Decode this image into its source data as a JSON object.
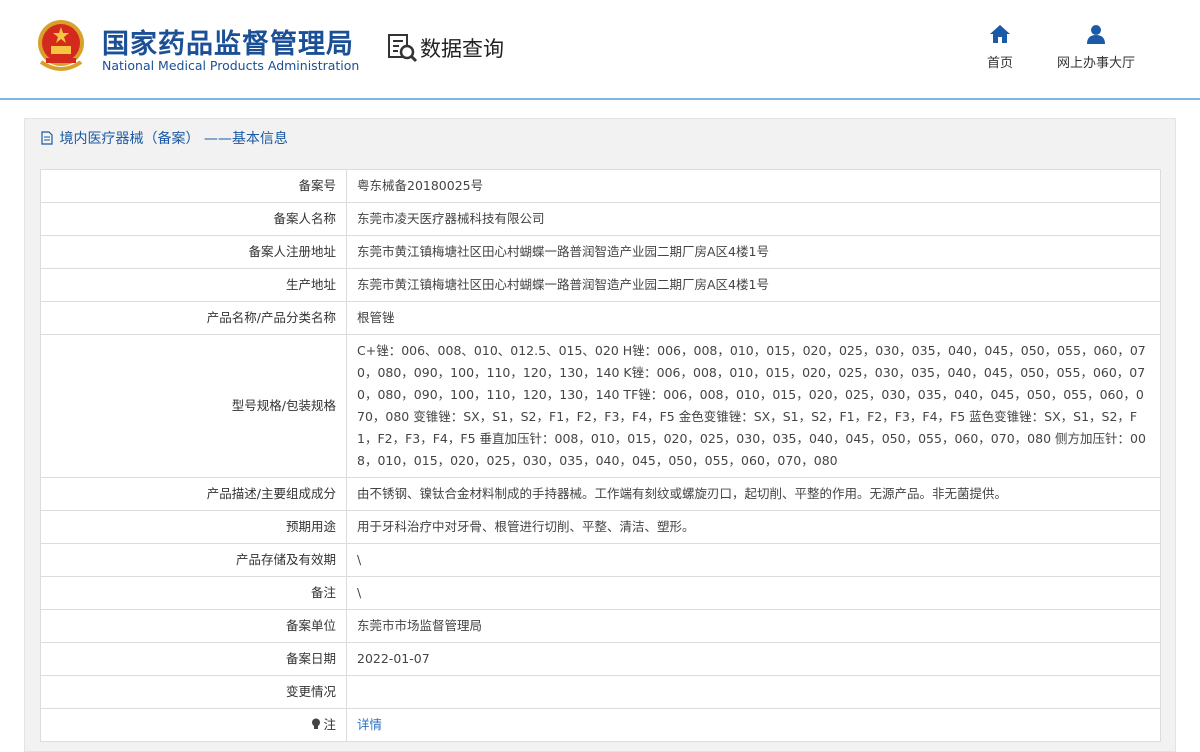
{
  "header": {
    "org_name_cn": "国家药品监督管理局",
    "org_name_en": "National Medical Products Administration",
    "section_title": "数据查询",
    "nav": [
      {
        "label": "首页",
        "icon": "home-icon"
      },
      {
        "label": "网上办事大厅",
        "icon": "user-icon"
      }
    ]
  },
  "panel": {
    "title": "境内医疗器械（备案） ——基本信息"
  },
  "record": [
    {
      "label": "备案号",
      "value": "粤东械备20180025号"
    },
    {
      "label": "备案人名称",
      "value": "东莞市凌天医疗器械科技有限公司"
    },
    {
      "label": "备案人注册地址",
      "value": "东莞市黄江镇梅塘社区田心村蝴蝶一路普润智造产业园二期厂房A区4楼1号"
    },
    {
      "label": "生产地址",
      "value": "东莞市黄江镇梅塘社区田心村蝴蝶一路普润智造产业园二期厂房A区4楼1号"
    },
    {
      "label": "产品名称/产品分类名称",
      "value": "根管锉"
    },
    {
      "label": "型号规格/包装规格",
      "value": "C+锉：006、008、010、012.5、015、020 H锉：006，008，010，015，020，025，030，035，040，045，050，055，060，070，080，090，100，110，120，130，140 K锉：006，008，010，015，020，025，030，035，040，045，050，055，060，070，080，090，100，110，120，130，140 TF锉：006，008，010，015，020，025，030，035，040，045，050，055，060，070，080 变锥锉：SX，S1，S2，F1，F2，F3，F4，F5 金色变锥锉：SX，S1，S2，F1，F2，F3，F4，F5 蓝色变锥锉：SX，S1，S2，F1，F2，F3，F4，F5 垂直加压针：008，010，015，020，025，030，035，040，045，050，055，060，070，080 侧方加压针：008，010，015，020，025，030，035，040，045，050，055，060，070，080"
    },
    {
      "label": "产品描述/主要组成成分",
      "value": "由不锈钢、镍钛合金材料制成的手持器械。工作端有刻纹或螺旋刃口，起切削、平整的作用。无源产品。非无菌提供。"
    },
    {
      "label": "预期用途",
      "value": "用于牙科治疗中对牙骨、根管进行切削、平整、清洁、塑形。"
    },
    {
      "label": "产品存储及有效期",
      "value": "\\"
    },
    {
      "label": "备注",
      "value": "\\"
    },
    {
      "label": "备案单位",
      "value": "东莞市市场监督管理局"
    },
    {
      "label": "备案日期",
      "value": "2022-01-07"
    },
    {
      "label": "变更情况",
      "value": ""
    },
    {
      "label": "注",
      "value": "详情"
    }
  ]
}
